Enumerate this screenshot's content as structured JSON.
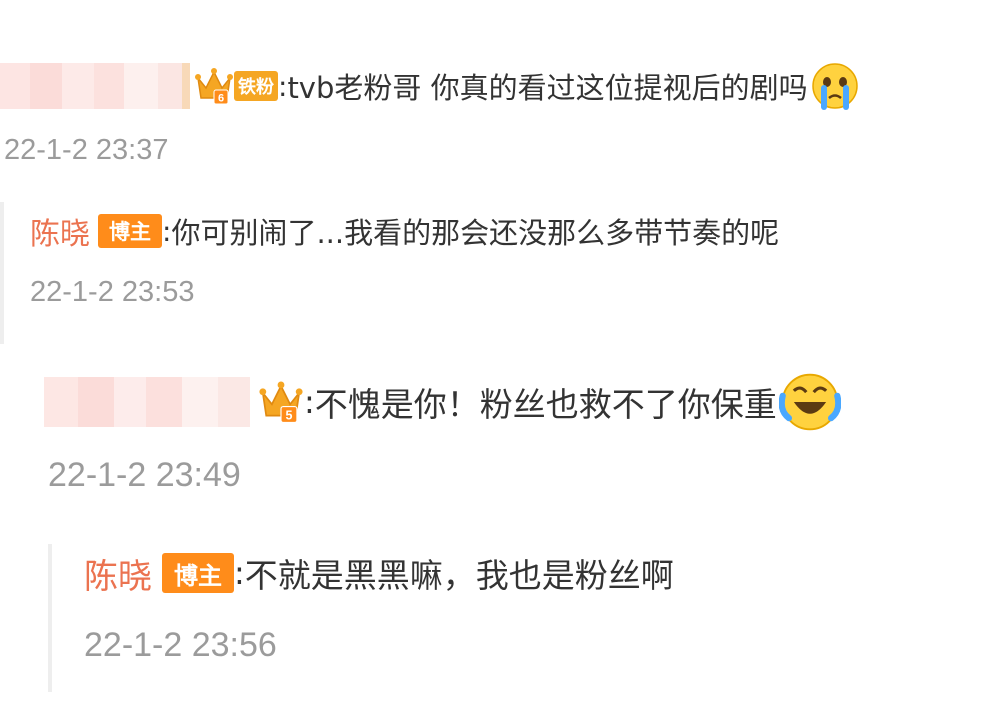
{
  "comments": [
    {
      "fan_badge": "铁粉",
      "fan_level": "6",
      "separator": ":",
      "text": "tvb老粉哥 你真的看过这位提视后的剧吗",
      "emoji": "crying-emoji",
      "time": "22-1-2 23:37",
      "reply": {
        "author": "陈晓",
        "badge": "博主",
        "separator": ":",
        "text": "你可别闹了...我看的那会还没那么多带节奏的呢",
        "time": "22-1-2 23:53"
      }
    },
    {
      "fan_level": "5",
      "separator": ":",
      "text": "不愧是你！粉丝也救不了你保重",
      "emoji": "laughing-tears-emoji",
      "time": "22-1-2 23:49",
      "reply": {
        "author": "陈晓",
        "badge": "博主",
        "separator": ":",
        "text": "不就是黑黑嘛，我也是粉丝啊",
        "time": "22-1-2 23:56"
      }
    }
  ],
  "colors": {
    "author": "#eb7350",
    "badge": "#ff8c1a",
    "timestamp": "#9b9b9b",
    "text": "#333333",
    "crown": "#f5a623"
  }
}
